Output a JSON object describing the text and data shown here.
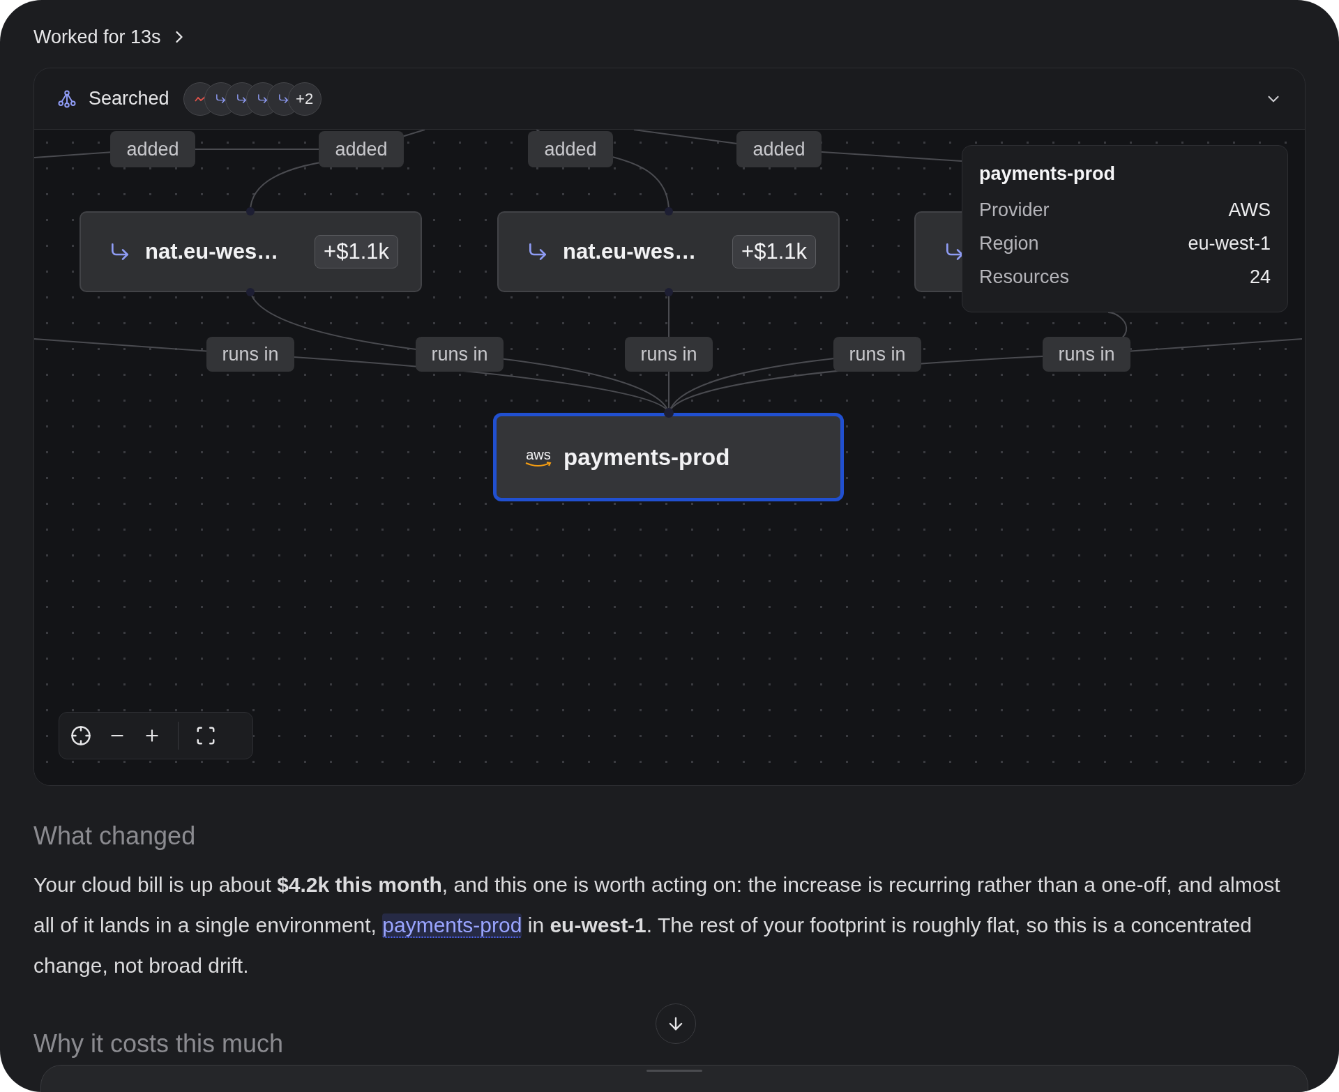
{
  "header": {
    "title": "Worked for 13s"
  },
  "panel": {
    "title": "Searched",
    "sources": [
      {
        "kind": "trend"
      },
      {
        "kind": "link"
      },
      {
        "kind": "link"
      },
      {
        "kind": "link"
      },
      {
        "kind": "link"
      }
    ],
    "more": "+2"
  },
  "graph": {
    "top_labels": [
      "added",
      "added",
      "added",
      "added"
    ],
    "nodes": [
      {
        "kind": "full",
        "label": "nat.eu-wes…",
        "cost": "+$1.1k"
      },
      {
        "kind": "full",
        "label": "nat.eu-wes…",
        "cost": "+$1.1k"
      },
      {
        "kind": "covered"
      }
    ],
    "bottom_labels": [
      "runs in",
      "runs in",
      "runs in",
      "runs in",
      "runs in"
    ],
    "target": {
      "logo": "aws",
      "label": "payments-prod",
      "selected": true
    },
    "tooltip": {
      "title": "payments-prod",
      "rows": [
        {
          "label": "Provider",
          "value": "AWS"
        },
        {
          "label": "Region",
          "value": "eu-west-1"
        },
        {
          "label": "Resources",
          "value": "24"
        }
      ]
    }
  },
  "section": {
    "heading": "What changed",
    "before": "Your cloud bill is up about **$4.2k this month**, and this one is worth acting on: the increase is recurring rather than a one-off, and almost all of it lands in a single environment, ",
    "link": "payments-prod",
    "after": " in **eu-west-1**. The rest of your footprint is roughly flat, so this is a concentrated change, not broad drift."
  },
  "next_heading": "Why it costs this much"
}
